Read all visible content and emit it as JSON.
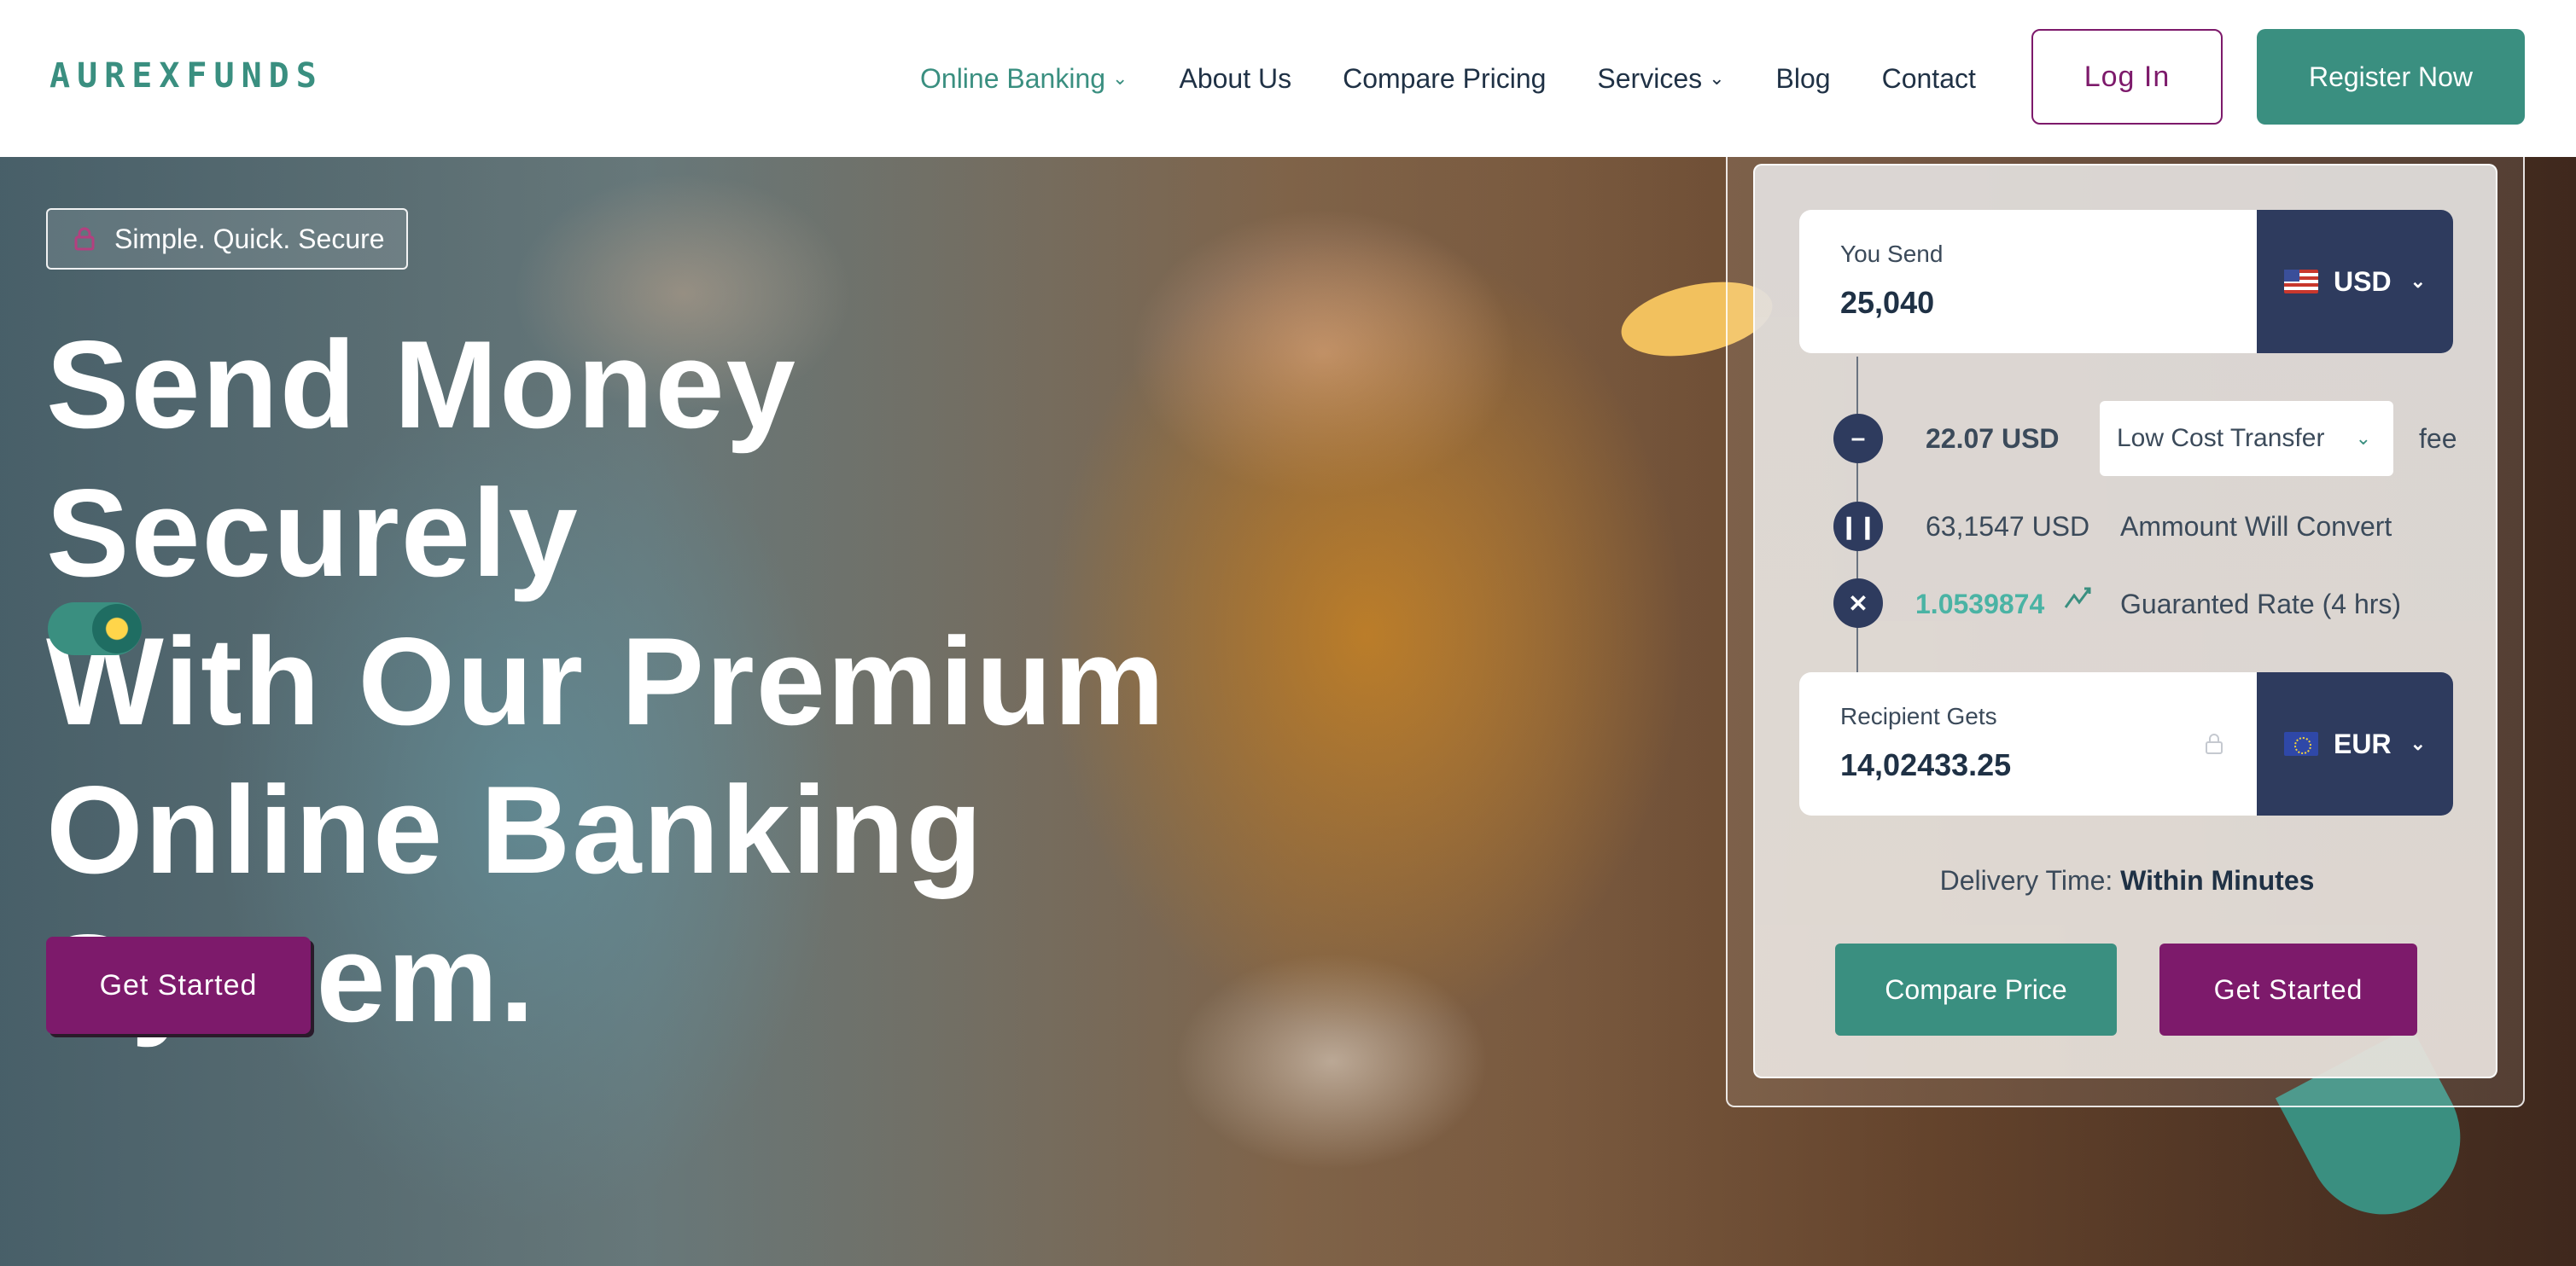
{
  "brand": {
    "logo_text": "AUREXFUNDS",
    "primary_color": "#3a8f80",
    "accent_color": "#7d1a6b",
    "navy": "#2e3b5e"
  },
  "nav": {
    "items": [
      {
        "label": "Online Banking",
        "has_dropdown": true,
        "active": true
      },
      {
        "label": "About Us"
      },
      {
        "label": "Compare Pricing"
      },
      {
        "label": "Services",
        "has_dropdown": true
      },
      {
        "label": "Blog"
      },
      {
        "label": "Contact"
      }
    ],
    "login_label": "Log In",
    "register_label": "Register Now"
  },
  "hero": {
    "badge": "Simple. Quick. Secure",
    "headline_lines": [
      "Send Money Securely",
      "With Our Premium",
      "Online Banking",
      "System."
    ],
    "cta_label": "Get Started"
  },
  "converter": {
    "send": {
      "label": "You Send",
      "value": "25,040",
      "currency": "USD",
      "flag": "us-flag"
    },
    "fee": {
      "value": "22.07 USD",
      "method": "Low Cost Transfer",
      "suffix": "fee"
    },
    "convert": {
      "value": "63,1547 USD",
      "label": "Ammount Will Convert"
    },
    "rate": {
      "value": "1.0539874",
      "label": "Guaranted Rate (4 hrs)"
    },
    "receive": {
      "label": "Recipient Gets",
      "value": "14,02433.25",
      "currency": "EUR",
      "flag": "eu-flag"
    },
    "delivery_label": "Delivery Time:",
    "delivery_value": "Within Minutes",
    "compare_label": "Compare Price",
    "start_label": "Get Started"
  }
}
